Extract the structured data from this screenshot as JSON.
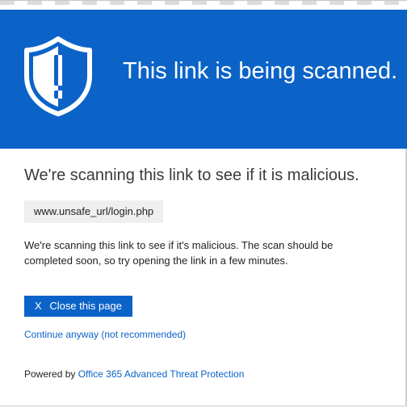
{
  "banner": {
    "title": "This link is being scanned.",
    "background_color": "#0b63c8",
    "icon": "shield-exclamation-icon"
  },
  "main": {
    "heading": "We're scanning this link to see if it is malicious.",
    "url": "www.unsafe_url/login.php",
    "description": "We're scanning this link to see if it's malicious. The scan should be completed soon, so try opening the link in a few minutes.",
    "close_button_x": "X",
    "close_button_label": "Close this page",
    "continue_link": "Continue anyway (not recommended)",
    "powered_by_prefix": "Powered by",
    "powered_by_link": "Office 365 Advanced Threat Protection"
  },
  "colors": {
    "accent": "#0b63c8",
    "url_box": "#efefef"
  }
}
